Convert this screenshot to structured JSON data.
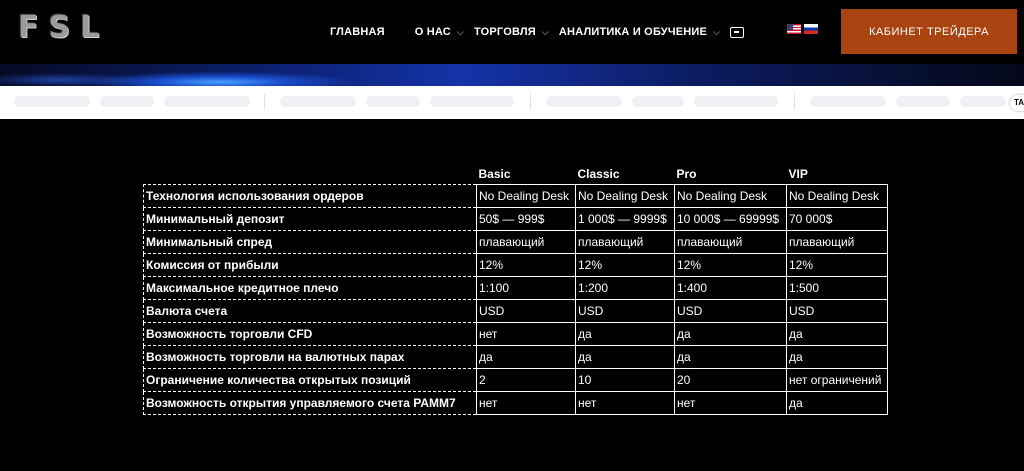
{
  "header": {
    "logo": "FSL",
    "nav": [
      {
        "label": "ГЛАВНАЯ"
      },
      {
        "label": "О НАС"
      },
      {
        "label": "ТОРГОВЛЯ"
      },
      {
        "label": "АНАЛИТИКА И ОБУЧЕНИЕ"
      }
    ],
    "cta_label": "КАБИНЕТ ТРЕЙДЕРА",
    "languages": [
      "en",
      "ru"
    ]
  },
  "ticker": {
    "tag": "TA"
  },
  "plans_table": {
    "columns": [
      "Basic",
      "Classic",
      "Pro",
      "VIP"
    ],
    "rows": [
      {
        "label": "Технология использования ордеров",
        "values": [
          "No Dealing Desk",
          "No Dealing Desk",
          "No Dealing Desk",
          "No Dealing Desk"
        ]
      },
      {
        "label": "Минимальный депозит",
        "values": [
          "50$ — 999$",
          "1 000$ — 9999$",
          "10 000$ — 69999$",
          "70 000$"
        ]
      },
      {
        "label": "Минимальный спред",
        "values": [
          "плавающий",
          "плавающий",
          "плавающий",
          "плавающий"
        ]
      },
      {
        "label": "Комиссия от прибыли",
        "values": [
          "12%",
          "12%",
          "12%",
          "12%"
        ]
      },
      {
        "label": "Максимальное кредитное плечо",
        "values": [
          "1:100",
          "1:200",
          "1:400",
          "1:500"
        ]
      },
      {
        "label": "Валюта счета",
        "values": [
          "USD",
          "USD",
          "USD",
          "USD"
        ]
      },
      {
        "label": "Возможность торговли CFD",
        "values": [
          "нет",
          "да",
          "да",
          "да"
        ]
      },
      {
        "label": "Возможность торговли на валютных парах",
        "values": [
          "да",
          "да",
          "да",
          "да"
        ]
      },
      {
        "label": "Ограничение количества открытых позиций",
        "values": [
          "2",
          "10",
          "20",
          "нет ограничений"
        ]
      },
      {
        "label": "Возможность открытия управляемого счета PAMM7",
        "values": [
          "нет",
          "нет",
          "нет",
          "да"
        ]
      }
    ]
  },
  "colors": {
    "background": "#000000",
    "accent": "#a9430f",
    "text": "#ffffff"
  }
}
